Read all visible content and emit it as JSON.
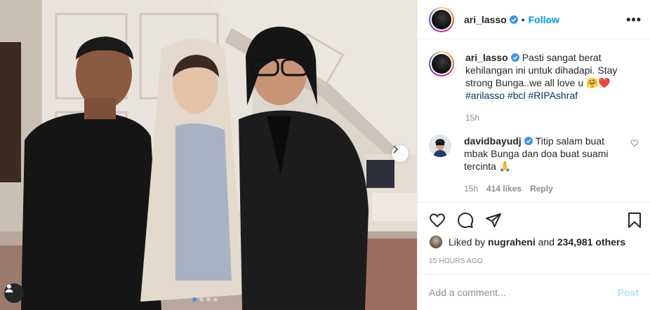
{
  "post": {
    "username": "ari_lasso",
    "follow_label": "Follow",
    "more_label": "•••",
    "image_count": 4,
    "active_image": 1
  },
  "caption": {
    "username": "ari_lasso",
    "text": "Pasti sangat berat kehilangan ini untuk dihadapi. Stay strong Bunga..we all love u 🤗❤️",
    "hashtags": [
      "#arilasso",
      "#bcl",
      "#RIPAshraf"
    ],
    "time": "15h"
  },
  "comment": {
    "username": "davidbayudj",
    "text": "Titip salam buat mbak Bunga dan doa buat suami tercinta 🙏",
    "time": "15h",
    "likes": "414 likes",
    "reply": "Reply"
  },
  "likes": {
    "prefix": "Liked by",
    "user": "nugraheni",
    "connector": "and",
    "others": "234,981 others"
  },
  "timestamp": "15 HOURS AGO",
  "composer": {
    "placeholder": "Add a comment...",
    "post_label": "Post"
  },
  "colors": {
    "accent": "#0095f6",
    "verified": "#3897f0",
    "hashtag": "#00376b",
    "muted": "#8e8e8e",
    "post_disabled": "#b2dffc"
  },
  "icons": [
    "user-tag-icon",
    "next-arrow-icon",
    "verified-icon",
    "more-icon",
    "heart-icon",
    "comment-icon",
    "share-icon",
    "bookmark-icon"
  ]
}
